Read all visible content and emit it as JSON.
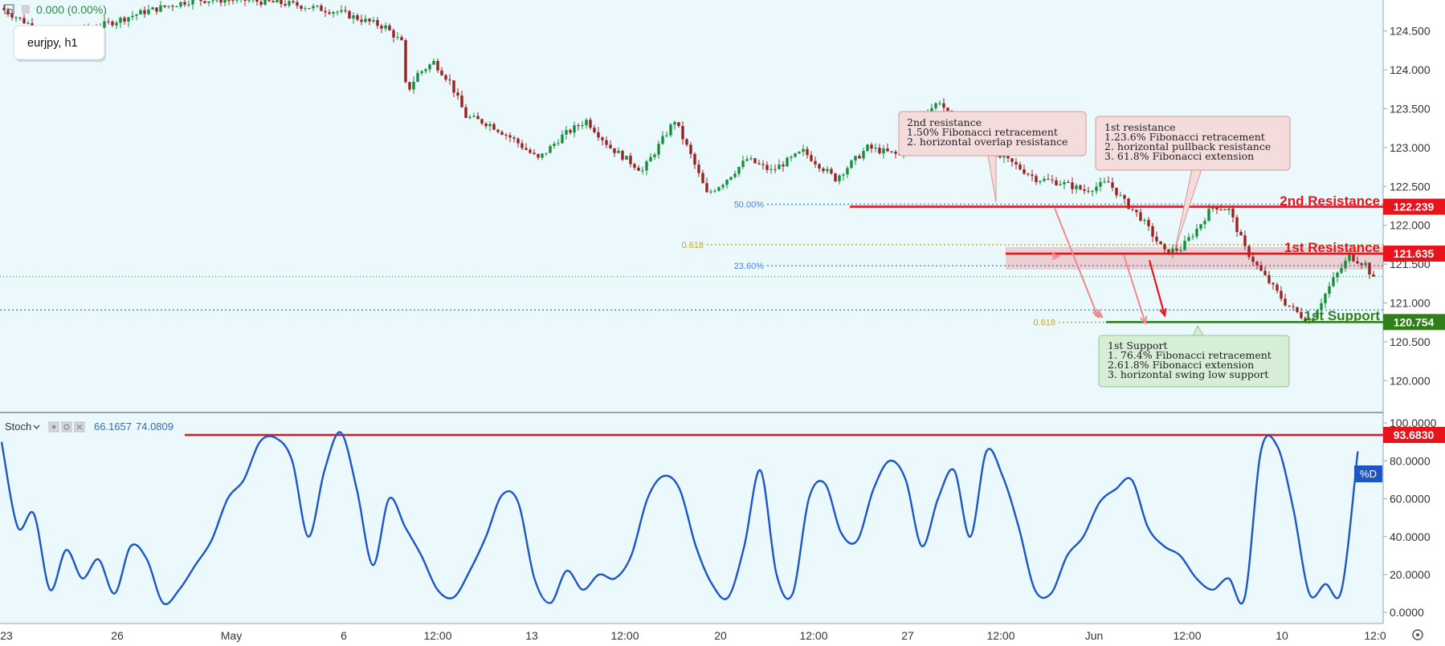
{
  "header": {
    "collapse_icon": "minus-square-icon",
    "flag_icon": "flag-icon",
    "price_change": "0.000 (0.00%)"
  },
  "symbol_label": "eurjpy, h1",
  "stoch_legend": {
    "name": "Stoch",
    "chevron_icon": "chevron-down-icon",
    "button_icons": [
      "eye-icon",
      "gear-icon",
      "close-icon"
    ],
    "k_value": "66.1657",
    "d_value": "74.0809"
  },
  "colors": {
    "background": "#ebf8fc",
    "resistance": "#e8141c",
    "support": "#307f19",
    "stoch_line": "#1e56c6",
    "candle_up": "#168f3a",
    "candle_down": "#9b2121",
    "fib_blue": "#4a86d3",
    "fib_gold": "#c9a227"
  },
  "chart_data": [
    {
      "type": "candlestick",
      "symbol": "eurjpy",
      "timeframe": "h1",
      "ylim": [
        119.6,
        124.9
      ],
      "y_ticks": [
        "124.500",
        "124.000",
        "123.500",
        "123.000",
        "122.500",
        "122.000",
        "121.500",
        "121.000",
        "120.500",
        "120.000"
      ],
      "x_ticks": [
        "23",
        "26",
        "May",
        "6",
        "12:00",
        "13",
        "12:00",
        "20",
        "12:00",
        "27",
        "12:00",
        "Jun",
        "12:00",
        "10",
        "12:0"
      ],
      "price_path": [
        [
          0,
          124.8
        ],
        [
          3,
          124.45
        ],
        [
          6,
          124.55
        ],
        [
          9,
          124.75
        ],
        [
          12,
          124.9
        ],
        [
          15,
          124.9
        ],
        [
          18,
          124.85
        ],
        [
          21,
          124.75
        ],
        [
          24,
          124.55
        ],
        [
          25,
          124.35
        ],
        [
          25.3,
          123.7
        ],
        [
          26,
          123.95
        ],
        [
          27,
          124.1
        ],
        [
          28,
          123.85
        ],
        [
          29,
          123.4
        ],
        [
          30.5,
          123.3
        ],
        [
          32,
          123.1
        ],
        [
          33.5,
          122.85
        ],
        [
          35,
          123.15
        ],
        [
          36.5,
          123.35
        ],
        [
          38,
          123.0
        ],
        [
          40,
          122.7
        ],
        [
          42,
          123.35
        ],
        [
          43,
          122.9
        ],
        [
          44,
          122.4
        ],
        [
          45,
          122.55
        ],
        [
          46.5,
          122.85
        ],
        [
          48,
          122.7
        ],
        [
          50,
          122.95
        ],
        [
          52,
          122.6
        ],
        [
          54,
          123.0
        ],
        [
          56,
          122.9
        ],
        [
          57,
          123.35
        ],
        [
          58.5,
          123.6
        ],
        [
          60,
          123.1
        ],
        [
          61,
          123.0
        ],
        [
          63,
          122.8
        ],
        [
          64.5,
          122.6
        ],
        [
          66,
          122.55
        ],
        [
          67.5,
          122.45
        ],
        [
          69,
          122.55
        ],
        [
          70,
          122.3
        ],
        [
          71,
          122.1
        ],
        [
          72.5,
          121.65
        ],
        [
          73.5,
          121.7
        ],
        [
          74.5,
          121.95
        ],
        [
          75.5,
          122.25
        ],
        [
          76.5,
          122.2
        ],
        [
          77.5,
          121.7
        ],
        [
          78.5,
          121.4
        ],
        [
          80,
          121.0
        ],
        [
          81.5,
          120.75
        ],
        [
          83,
          121.3
        ],
        [
          84,
          121.6
        ],
        [
          85,
          121.5
        ],
        [
          85.5,
          121.3
        ]
      ],
      "series": [
        {
          "name": "2nd Resistance",
          "price": "122.239",
          "value": 122.239
        },
        {
          "name": "1st Resistance",
          "price": "121.635",
          "value": 121.635
        },
        {
          "name": "1st Support",
          "price": "120.754",
          "value": 120.754
        }
      ],
      "fib_levels": [
        {
          "label": "50.00%",
          "value": 122.27,
          "color": "blue"
        },
        {
          "label": "0.618",
          "value": 121.75,
          "color": "gold"
        },
        {
          "label": "23.60%",
          "value": 121.48,
          "color": "blue"
        },
        {
          "label": "0.618",
          "value": 120.75,
          "color": "gold"
        }
      ],
      "annotations": [
        {
          "title": "2nd resistance",
          "lines": [
            "1.50% Fibonacci retracement",
            "2. horizontal overlap resistance"
          ]
        },
        {
          "title": "1st resistance",
          "lines": [
            "1.23.6% Fibonacci retracement",
            "2. horizontal pullback resistance",
            "3. 61.8% Fibonacci extension"
          ]
        },
        {
          "title": "1st Support",
          "lines": [
            "1. 76.4% Fibonacci retracement",
            "2.61.8% Fibonacci extension",
            "3. horizontal swing low support"
          ]
        }
      ]
    },
    {
      "type": "line",
      "indicator": "Stoch",
      "series_label": "%D",
      "ylim": [
        -5,
        103
      ],
      "y_ticks": [
        "100.0000",
        "80.0000",
        "60.0000",
        "40.0000",
        "20.0000",
        "0.0000"
      ],
      "level": {
        "value": 93.683,
        "label": "93.6830"
      },
      "x": [
        0,
        1,
        2,
        3,
        4,
        5,
        6,
        7,
        8,
        9,
        10,
        11,
        12,
        13,
        14,
        15,
        16,
        17,
        18,
        19,
        20,
        21,
        22,
        23,
        24,
        25,
        26,
        27,
        28,
        29,
        30,
        31,
        32,
        33,
        34,
        35,
        36,
        37,
        38,
        39,
        40,
        41,
        42,
        43,
        44,
        45,
        46,
        47,
        48,
        49,
        50,
        51,
        52,
        53,
        54,
        55,
        56,
        57,
        58,
        59,
        60,
        61,
        62,
        63,
        64,
        65,
        66,
        67,
        68,
        69,
        70,
        71,
        72,
        73,
        74,
        75,
        76,
        77,
        78,
        79,
        80,
        81,
        82,
        83,
        84
      ],
      "values": [
        90,
        45,
        52,
        12,
        33,
        18,
        28,
        10,
        35,
        28,
        5,
        12,
        25,
        38,
        60,
        70,
        90,
        92,
        80,
        40,
        75,
        95,
        65,
        25,
        60,
        45,
        30,
        12,
        8,
        22,
        40,
        62,
        58,
        18,
        5,
        22,
        12,
        20,
        18,
        30,
        60,
        72,
        65,
        35,
        15,
        8,
        35,
        75,
        20,
        10,
        60,
        68,
        42,
        38,
        65,
        80,
        70,
        35,
        60,
        75,
        40,
        85,
        72,
        45,
        12,
        10,
        30,
        40,
        58,
        65,
        70,
        45,
        35,
        30,
        18,
        12,
        18,
        8,
        85,
        88,
        55,
        10,
        15,
        12,
        85
      ]
    }
  ]
}
